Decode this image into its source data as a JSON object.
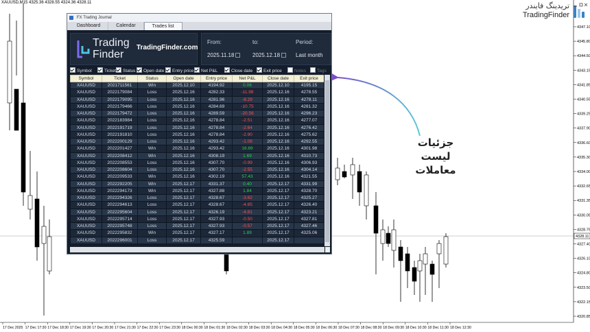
{
  "chart": {
    "symbol_info": "XAUUSD,M15  4325.36 4328.55 4324.36 4328.11",
    "price_labels": [
      "4347.10",
      "4345.80",
      "4344.50",
      "4343.15",
      "4341.85",
      "4340.55",
      "4339.25",
      "4337.90",
      "4336.60",
      "4335.30",
      "4334.00",
      "4332.65",
      "4331.35",
      "4330.05",
      "4328.75",
      "4327.40",
      "4326.10",
      "4324.80",
      "4323.50",
      "4322.15",
      "4320.85"
    ],
    "current_price": "4328.11",
    "time_labels": [
      "17 Dec 2025",
      "17 Dec 17:30",
      "17 Dec 18:30",
      "17 Dec 19:30",
      "17 Dec 20:30",
      "17 Dec 21:30",
      "17 Dec 22:30",
      "17 Dec 23:30",
      "18 Dec 00:30",
      "18 Dec 01:30",
      "18 Dec 02:30",
      "18 Dec 03:30",
      "18 Dec 04:30",
      "18 Dec 05:30",
      "18 Dec 06:30",
      "18 Dec 07:30",
      "18 Dec 08:30",
      "18 Dec 09:30",
      "18 Dec 10:30",
      "18 Dec 11:30",
      "18 Dec 12:30"
    ],
    "colors": {
      "bull": "#ffffff",
      "bear": "#000000",
      "wick": "#000000",
      "current_line": "#9aa0a6"
    }
  },
  "brand": {
    "fa": "تریدینگ فایندر",
    "en": "TradingFinder"
  },
  "annotation": {
    "line1": "جزئیات لیست",
    "line2": "معاملات",
    "arrow_color": "#5bc8d8"
  },
  "window": {
    "title": "FX Trading Journal",
    "tabs": [
      "Dashboard",
      "Calendar",
      "Trades list"
    ],
    "active_tab": "Trades list",
    "logo_text_1": "Trading",
    "logo_text_2": "Finder",
    "logo_url": "TradingFinder.com",
    "from_label": "From:",
    "to_label": "to:",
    "period_label": "Period:",
    "from_value": "2025.11.18",
    "to_value": "2025.12.18",
    "period_value": "Last month",
    "columns": [
      {
        "label": "Symbol",
        "checked": true
      },
      {
        "label": "Ticket",
        "checked": true
      },
      {
        "label": "Status",
        "checked": true
      },
      {
        "label": "Open date",
        "checked": true
      },
      {
        "label": "Entry price",
        "checked": true
      },
      {
        "label": "Net P&L",
        "checked": true
      },
      {
        "label": "Close date",
        "checked": true
      },
      {
        "label": "Exit price",
        "checked": true
      },
      {
        "label": "Notes",
        "checked": false
      },
      {
        "label": "Tags",
        "checked": false
      }
    ],
    "headers": [
      "Symbol",
      "Ticket",
      "Status",
      "Open date",
      "Entry price",
      "Net P&L",
      "Close date",
      "Exit price"
    ],
    "rows": [
      [
        "XAUUSD",
        "2021711561",
        "Win",
        "2025.12.10",
        "4194.92",
        "0.06",
        "2025.12.10",
        "4195.15"
      ],
      [
        "XAUUSD",
        "2022179084",
        "Loss",
        "2025.12.16",
        "4282.33",
        "-11.98",
        "2025.12.16",
        "4278.55"
      ],
      [
        "XAUUSD",
        "2022179095",
        "Loss",
        "2025.12.16",
        "4281.96",
        "-8.29",
        "2025.12.16",
        "4278.11"
      ],
      [
        "XAUUSD",
        "2022179466",
        "Loss",
        "2025.12.16",
        "4284.69",
        "-10.75",
        "2025.12.16",
        "4281.32"
      ],
      [
        "XAUUSD",
        "2022179472",
        "Loss",
        "2025.12.16",
        "4289.59",
        "-20.56",
        "2025.12.16",
        "4296.23"
      ],
      [
        "XAUUSD",
        "2022183984",
        "Loss",
        "2025.12.16",
        "4278.84",
        "-2.51",
        "2025.12.16",
        "4277.07"
      ],
      [
        "XAUUSD",
        "2022191719",
        "Loss",
        "2025.12.16",
        "4278.84",
        "-2.64",
        "2025.12.16",
        "4276.42"
      ],
      [
        "XAUUSD",
        "2022191810",
        "Loss",
        "2025.12.16",
        "4278.84",
        "-2.90",
        "2025.12.16",
        "4275.62"
      ],
      [
        "XAUUSD",
        "2022200129",
        "Loss",
        "2025.12.16",
        "4293.42",
        "-1.08",
        "2025.12.16",
        "4292.55"
      ],
      [
        "XAUUSD",
        "2022201427",
        "Win",
        "2025.12.16",
        "4293.42",
        "16.69",
        "2025.12.16",
        "4301.98"
      ],
      [
        "XAUUSD",
        "2022208412",
        "Win",
        "2025.12.16",
        "4308.19",
        "1.69",
        "2025.12.16",
        "4310.73"
      ],
      [
        "XAUUSD",
        "2022208553",
        "Loss",
        "2025.12.16",
        "4307.70",
        "-0.99",
        "2025.12.16",
        "4306.93"
      ],
      [
        "XAUUSD",
        "2022208604",
        "Loss",
        "2025.12.16",
        "4307.70",
        "-2.55",
        "2025.12.16",
        "4304.14"
      ],
      [
        "XAUUSD",
        "2022209533",
        "Win",
        "2025.12.16",
        "4302.19",
        "57.43",
        "2025.12.16",
        "4321.55"
      ],
      [
        "XAUUSD",
        "2022292205",
        "Win",
        "2025.12.17",
        "4331.37",
        "0.40",
        "2025.12.17",
        "4331.99"
      ],
      [
        "XAUUSD",
        "2022294173",
        "Win",
        "2025.12.17",
        "4327.88",
        "1.84",
        "2025.12.17",
        "4328.70"
      ],
      [
        "XAUUSD",
        "2022294326",
        "Loss",
        "2025.12.17",
        "4328.67",
        "-3.62",
        "2025.12.17",
        "4325.27"
      ],
      [
        "XAUUSD",
        "2022294613",
        "Loss",
        "2025.12.17",
        "4328.67",
        "-4.85",
        "2025.12.17",
        "4326.40"
      ],
      [
        "XAUUSD",
        "2022295604",
        "Loss",
        "2025.12.17",
        "4326.19",
        "-4.81",
        "2025.12.17",
        "4323.21"
      ],
      [
        "XAUUSD",
        "2022295714",
        "Loss",
        "2025.12.17",
        "4327.93",
        "-0.50",
        "2025.12.17",
        "4327.81"
      ],
      [
        "XAUUSD",
        "2022295748",
        "Loss",
        "2025.12.17",
        "4327.93",
        "-0.57",
        "2025.12.17",
        "4327.46"
      ],
      [
        "XAUUSD",
        "2022295832",
        "Win",
        "2025.12.17",
        "4327.17",
        "1.89",
        "2025.12.17",
        "4325.06"
      ],
      [
        "XAUUSD",
        "2022296001",
        "Loss",
        "2025.12.17",
        "4325.59",
        "",
        "2025.12.17",
        ""
      ]
    ]
  }
}
